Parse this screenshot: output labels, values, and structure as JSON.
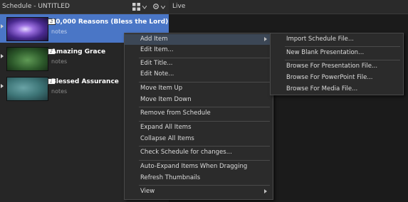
{
  "schedule": {
    "title": "Schedule - UNTITLED",
    "items": [
      {
        "title": "10,000 Reasons (Bless the Lord)",
        "notes": "notes",
        "selected": true
      },
      {
        "title": "Amazing Grace",
        "notes": "notes",
        "selected": false
      },
      {
        "title": "Blessed Assurance",
        "notes": "notes",
        "selected": false
      }
    ],
    "song_badge": "♫"
  },
  "live": {
    "title": "Live"
  },
  "context_menu": {
    "items": [
      {
        "label": "Add Item",
        "has_submenu": true,
        "highlighted": true
      },
      {
        "label": "Edit Item..."
      },
      {
        "label": "Edit Title..."
      },
      {
        "label": "Edit Note..."
      },
      {
        "label": "Move Item Up"
      },
      {
        "label": "Move Item Down"
      },
      {
        "label": "Remove from Schedule"
      },
      {
        "label": "Expand All Items"
      },
      {
        "label": "Collapse All Items"
      },
      {
        "label": "Check Schedule for changes..."
      },
      {
        "label": "Auto-Expand Items When Dragging"
      },
      {
        "label": "Refresh Thumbnails"
      },
      {
        "label": "View",
        "has_submenu": true
      }
    ]
  },
  "submenu": {
    "items": [
      {
        "label": "Import Schedule File..."
      },
      {
        "label": "New Blank Presentation..."
      },
      {
        "label": "Browse For Presentation File..."
      },
      {
        "label": "Browse For PowerPoint File..."
      },
      {
        "label": "Browse For Media File..."
      }
    ]
  },
  "colors": {
    "selection": "#4a76c6",
    "menu_highlight": "#3c4756",
    "panel_bg": "#262626"
  }
}
